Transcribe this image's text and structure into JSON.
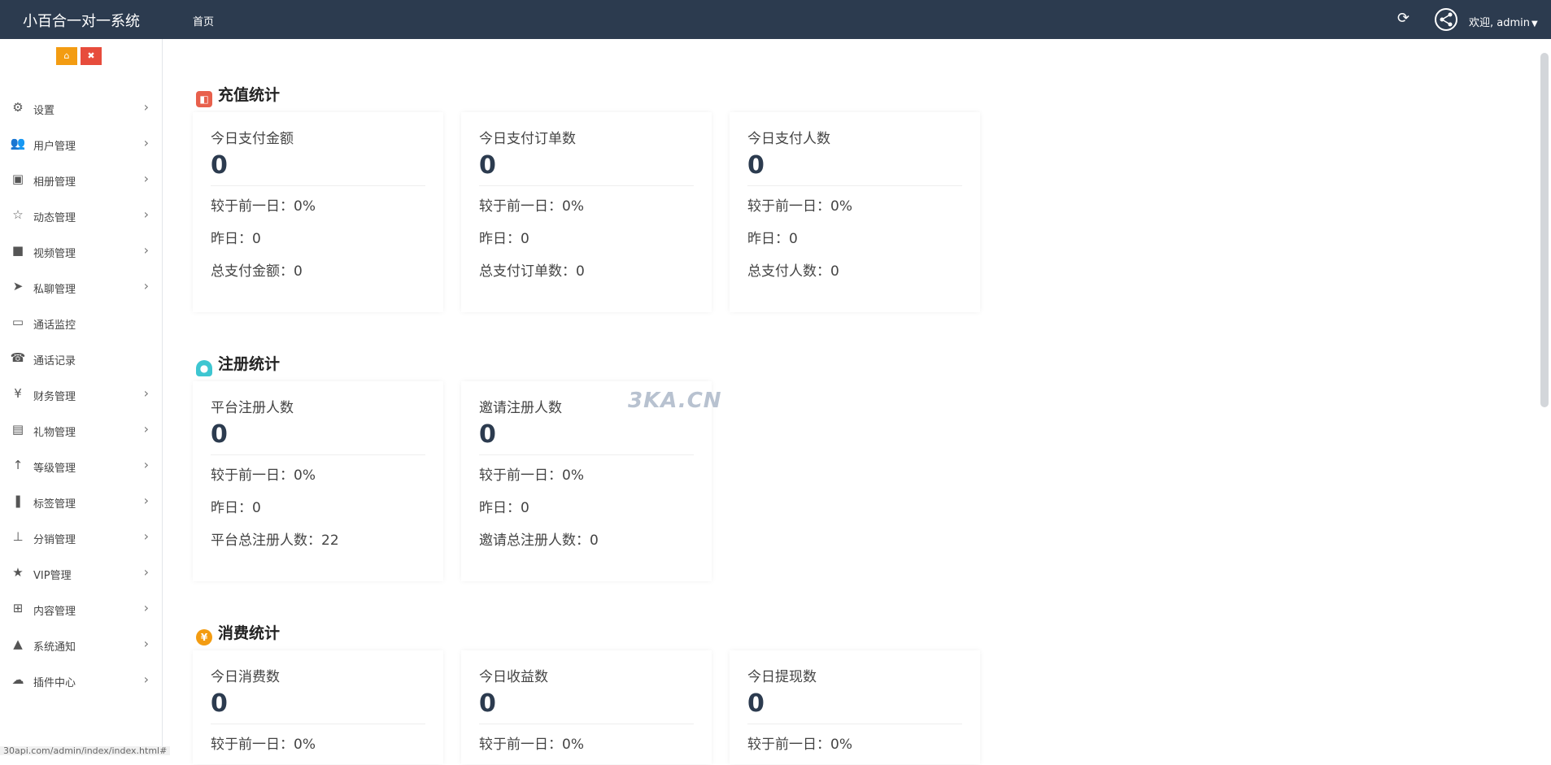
{
  "header": {
    "app_title": "小百合一对一系统",
    "nav_home": "首页",
    "welcome": "欢迎, admin"
  },
  "sidebar": {
    "items": [
      {
        "label": "设置",
        "icon": "gears-icon",
        "arrow": true
      },
      {
        "label": "用户管理",
        "icon": "users-icon",
        "arrow": true
      },
      {
        "label": "相册管理",
        "icon": "image-icon",
        "arrow": true
      },
      {
        "label": "动态管理",
        "icon": "star-outline-icon",
        "arrow": true
      },
      {
        "label": "视频管理",
        "icon": "video-camera-icon",
        "arrow": true
      },
      {
        "label": "私聊管理",
        "icon": "telegram-icon",
        "arrow": true
      },
      {
        "label": "通话监控",
        "icon": "monitor-icon",
        "arrow": false
      },
      {
        "label": "通话记录",
        "icon": "phone-icon",
        "arrow": false
      },
      {
        "label": "财务管理",
        "icon": "yen-icon",
        "arrow": true
      },
      {
        "label": "礼物管理",
        "icon": "gift-icon",
        "arrow": true
      },
      {
        "label": "等级管理",
        "icon": "level-up-icon",
        "arrow": true
      },
      {
        "label": "标签管理",
        "icon": "bookmark-icon",
        "arrow": true
      },
      {
        "label": "分销管理",
        "icon": "sitemap-icon",
        "arrow": true
      },
      {
        "label": "VIP管理",
        "icon": "star-icon",
        "arrow": true
      },
      {
        "label": "内容管理",
        "icon": "grid-icon",
        "arrow": true
      },
      {
        "label": "系统通知",
        "icon": "bell-icon",
        "arrow": true
      },
      {
        "label": "插件中心",
        "icon": "cloud-icon",
        "arrow": true
      }
    ]
  },
  "sections": {
    "recharge": {
      "title": "充值统计",
      "cards": [
        {
          "title": "今日支付金额",
          "value": "0",
          "l1": "较于前一日：0%",
          "l2": "昨日：0",
          "l3": "总支付金额：0"
        },
        {
          "title": "今日支付订单数",
          "value": "0",
          "l1": "较于前一日：0%",
          "l2": "昨日：0",
          "l3": "总支付订单数：0"
        },
        {
          "title": "今日支付人数",
          "value": "0",
          "l1": "较于前一日：0%",
          "l2": "昨日：0",
          "l3": "总支付人数：0"
        }
      ]
    },
    "register": {
      "title": "注册统计",
      "cards": [
        {
          "title": "平台注册人数",
          "value": "0",
          "l1": "较于前一日：0%",
          "l2": "昨日：0",
          "l3": "平台总注册人数：22"
        },
        {
          "title": "邀请注册人数",
          "value": "0",
          "l1": "较于前一日：0%",
          "l2": "昨日：0",
          "l3": "邀请总注册人数：0"
        }
      ]
    },
    "consume": {
      "title": "消费统计",
      "cards": [
        {
          "title": "今日消费数",
          "value": "0",
          "l1": "较于前一日：0%"
        },
        {
          "title": "今日收益数",
          "value": "0",
          "l1": "较于前一日：0%"
        },
        {
          "title": "今日提现数",
          "value": "0",
          "l1": "较于前一日：0%"
        }
      ]
    }
  },
  "watermark": "3KA.CN",
  "status_url": "30api.com/admin/index/index.html#"
}
